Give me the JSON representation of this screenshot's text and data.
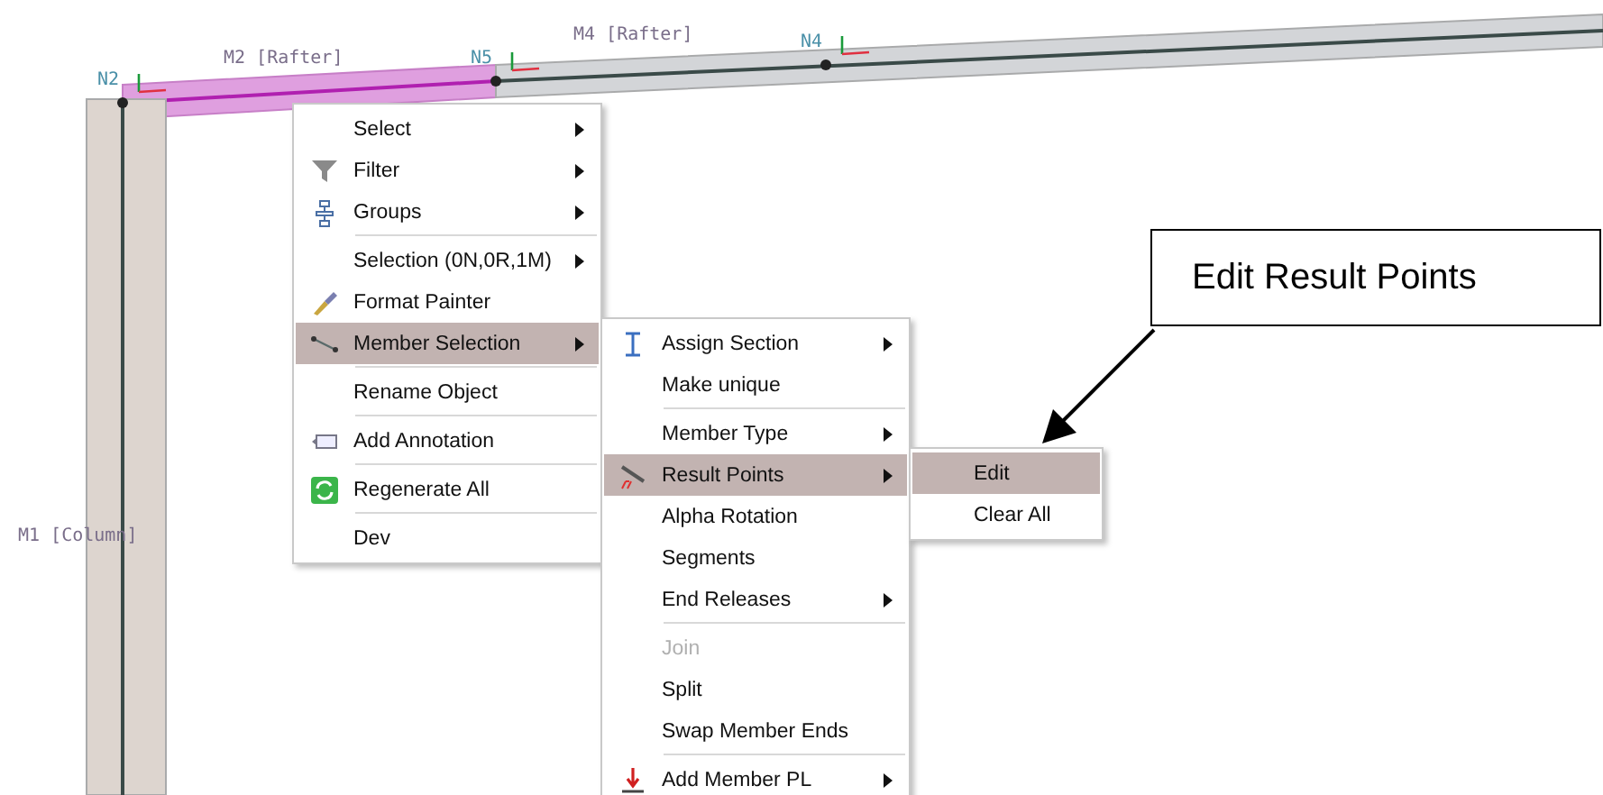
{
  "canvas": {
    "members": [
      {
        "label": "M2 [Rafter]",
        "selected": true
      },
      {
        "label": "M4 [Rafter]",
        "selected": false
      },
      {
        "label": "M1 [Column]",
        "selected": false
      }
    ],
    "nodes": [
      {
        "label": "N2"
      },
      {
        "label": "N5"
      },
      {
        "label": "N4"
      }
    ]
  },
  "context_menu": {
    "items": [
      {
        "label": "Select",
        "submenu": true,
        "selected": false
      },
      {
        "label": "Filter",
        "submenu": true,
        "selected": false
      },
      {
        "label": "Groups",
        "submenu": true,
        "selected": false
      },
      {
        "label": "Selection (0N,0R,1M)",
        "submenu": true,
        "selected": false,
        "divider_above": true
      },
      {
        "label": "Format Painter",
        "submenu": false,
        "selected": false
      },
      {
        "label": "Member Selection",
        "submenu": true,
        "selected": true
      },
      {
        "label": "Rename Object",
        "submenu": false,
        "selected": false,
        "divider_above": true
      },
      {
        "label": "Add Annotation",
        "submenu": false,
        "selected": false,
        "divider_above": true
      },
      {
        "label": "Regenerate All",
        "submenu": false,
        "selected": false,
        "divider_above": true
      },
      {
        "label": "Dev",
        "submenu": false,
        "selected": false,
        "divider_above": true
      }
    ]
  },
  "member_submenu": {
    "items": [
      {
        "label": "Assign Section",
        "submenu": true,
        "selected": false,
        "disabled": false
      },
      {
        "label": "Make unique",
        "submenu": false,
        "selected": false,
        "disabled": false
      },
      {
        "label": "Member Type",
        "submenu": true,
        "selected": false,
        "disabled": false,
        "divider_above": true
      },
      {
        "label": "Result Points",
        "submenu": true,
        "selected": true,
        "disabled": false
      },
      {
        "label": "Alpha Rotation",
        "submenu": false,
        "selected": false,
        "disabled": false
      },
      {
        "label": "Segments",
        "submenu": false,
        "selected": false,
        "disabled": false
      },
      {
        "label": "End Releases",
        "submenu": true,
        "selected": false,
        "disabled": false
      },
      {
        "label": "Join",
        "submenu": false,
        "selected": false,
        "disabled": true,
        "divider_above": true
      },
      {
        "label": "Split",
        "submenu": false,
        "selected": false,
        "disabled": false
      },
      {
        "label": "Swap Member Ends",
        "submenu": false,
        "selected": false,
        "disabled": false
      },
      {
        "label": "Add Member PL",
        "submenu": true,
        "selected": false,
        "disabled": false,
        "divider_above": true
      }
    ]
  },
  "result_points_submenu": {
    "items": [
      {
        "label": "Edit",
        "selected": true
      },
      {
        "label": "Clear All",
        "selected": false
      }
    ]
  },
  "callout": {
    "text": "Edit Result Points"
  }
}
